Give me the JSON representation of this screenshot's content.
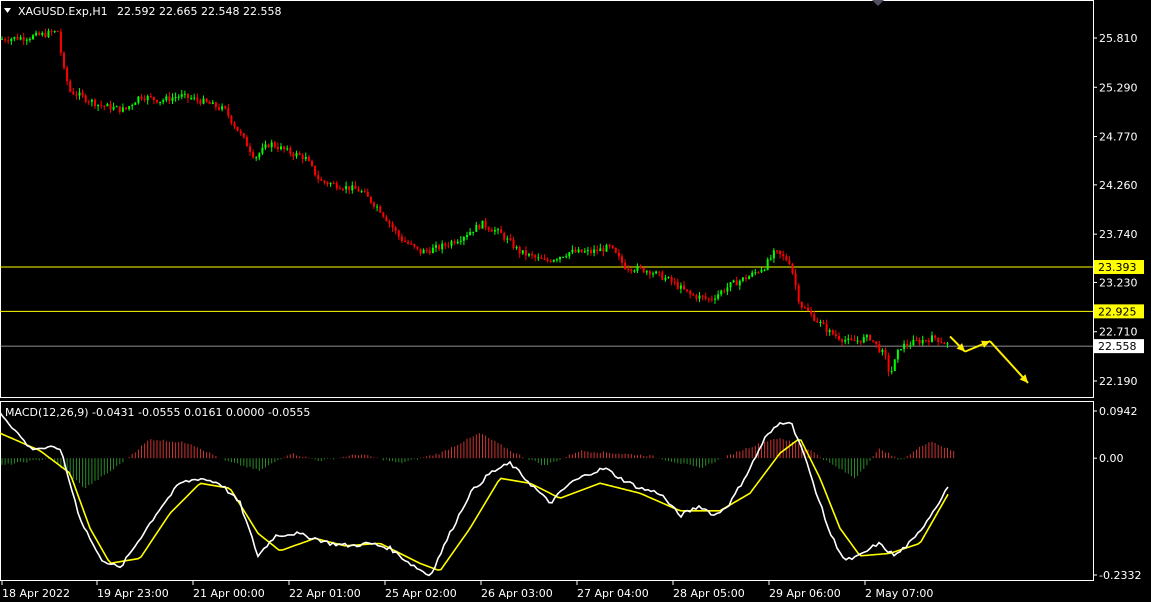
{
  "header": {
    "symbol": "XAGUSD.Exp,H1",
    "ohlc": "22.592 22.665 22.548 22.558",
    "macd_label": "MACD(12,26,9) -0.0431 -0.0555 0.0161 0.0000 -0.0555"
  },
  "colors": {
    "background": "#000000",
    "bull_candle": "#00ff00",
    "bear_candle": "#ff0000",
    "level_line": "#ffff00",
    "bid_line": "#c0c0c0",
    "macd_main": "#ffffff",
    "macd_signal": "#ffff00",
    "hist_pos": "#cc3333",
    "hist_neg": "#2a8a2a",
    "forecast_arrow": "#ffee00"
  },
  "chart_data": [
    {
      "type": "candlestick",
      "symbol": "XAGUSD",
      "timeframe": "H1",
      "ylim": [
        21.98,
        26.03
      ],
      "y_ticks": [
        "25.810",
        "25.290",
        "24.770",
        "24.260",
        "23.740",
        "23.230",
        "22.710",
        "22.190"
      ],
      "x_ticks": [
        "18 Apr 2022",
        "19 Apr 23:00",
        "21 Apr 00:00",
        "22 Apr 01:00",
        "25 Apr 02:00",
        "26 Apr 03:00",
        "27 Apr 04:00",
        "28 Apr 05:00",
        "29 Apr 06:00",
        "2 May 07:00"
      ],
      "close_path": [
        [
          0,
          25.8
        ],
        [
          30,
          25.82
        ],
        [
          45,
          25.85
        ],
        [
          58,
          25.88
        ],
        [
          63,
          25.5
        ],
        [
          70,
          25.25
        ],
        [
          100,
          25.1
        ],
        [
          125,
          25.05
        ],
        [
          140,
          25.2
        ],
        [
          160,
          25.15
        ],
        [
          180,
          25.2
        ],
        [
          200,
          25.15
        ],
        [
          225,
          25.05
        ],
        [
          240,
          24.8
        ],
        [
          255,
          24.55
        ],
        [
          270,
          24.7
        ],
        [
          290,
          24.6
        ],
        [
          305,
          24.55
        ],
        [
          320,
          24.3
        ],
        [
          340,
          24.25
        ],
        [
          360,
          24.2
        ],
        [
          380,
          24.0
        ],
        [
          400,
          23.7
        ],
        [
          420,
          23.55
        ],
        [
          440,
          23.6
        ],
        [
          460,
          23.7
        ],
        [
          482,
          23.85
        ],
        [
          500,
          23.75
        ],
        [
          520,
          23.55
        ],
        [
          545,
          23.45
        ],
        [
          570,
          23.55
        ],
        [
          590,
          23.55
        ],
        [
          610,
          23.6
        ],
        [
          625,
          23.4
        ],
        [
          650,
          23.35
        ],
        [
          670,
          23.25
        ],
        [
          690,
          23.1
        ],
        [
          710,
          23.05
        ],
        [
          730,
          23.2
        ],
        [
          750,
          23.3
        ],
        [
          765,
          23.4
        ],
        [
          775,
          23.55
        ],
        [
          790,
          23.45
        ],
        [
          800,
          23.0
        ],
        [
          815,
          22.85
        ],
        [
          830,
          22.7
        ],
        [
          850,
          22.6
        ],
        [
          870,
          22.65
        ],
        [
          885,
          22.45
        ],
        [
          890,
          22.25
        ],
        [
          900,
          22.55
        ],
        [
          915,
          22.6
        ],
        [
          935,
          22.65
        ],
        [
          950,
          22.56
        ]
      ],
      "levels": [
        {
          "label": "23.393",
          "value": 23.393
        },
        {
          "label": "22.925",
          "value": 22.925
        }
      ],
      "current_bid": {
        "label": "22.558",
        "value": 22.558
      },
      "forecast_path": [
        [
          950,
          22.66
        ],
        [
          965,
          22.5
        ],
        [
          990,
          22.61
        ],
        [
          1028,
          22.17
        ]
      ]
    },
    {
      "type": "macd",
      "params": "12,26,9",
      "ylim": [
        -0.2332,
        0.0942
      ],
      "y_ticks": [
        "0.0942",
        "0.00",
        "-0.2332"
      ],
      "main_path": [
        [
          0,
          0.092
        ],
        [
          30,
          0.02
        ],
        [
          60,
          0.02
        ],
        [
          80,
          -0.12
        ],
        [
          100,
          -0.2
        ],
        [
          120,
          -0.22
        ],
        [
          140,
          -0.16
        ],
        [
          160,
          -0.1
        ],
        [
          180,
          -0.05
        ],
        [
          200,
          -0.04
        ],
        [
          220,
          -0.05
        ],
        [
          240,
          -0.09
        ],
        [
          258,
          -0.195
        ],
        [
          275,
          -0.155
        ],
        [
          295,
          -0.15
        ],
        [
          315,
          -0.16
        ],
        [
          330,
          -0.17
        ],
        [
          350,
          -0.175
        ],
        [
          370,
          -0.17
        ],
        [
          390,
          -0.18
        ],
        [
          410,
          -0.21
        ],
        [
          430,
          -0.235
        ],
        [
          450,
          -0.15
        ],
        [
          470,
          -0.07
        ],
        [
          490,
          -0.03
        ],
        [
          510,
          -0.01
        ],
        [
          530,
          -0.05
        ],
        [
          550,
          -0.09
        ],
        [
          570,
          -0.05
        ],
        [
          590,
          -0.03
        ],
        [
          605,
          -0.02
        ],
        [
          620,
          -0.04
        ],
        [
          640,
          -0.06
        ],
        [
          660,
          -0.07
        ],
        [
          680,
          -0.115
        ],
        [
          700,
          -0.095
        ],
        [
          715,
          -0.115
        ],
        [
          730,
          -0.09
        ],
        [
          750,
          -0.02
        ],
        [
          765,
          0.04
        ],
        [
          780,
          0.07
        ],
        [
          790,
          0.075
        ],
        [
          800,
          0.03
        ],
        [
          815,
          -0.06
        ],
        [
          830,
          -0.15
        ],
        [
          845,
          -0.205
        ],
        [
          860,
          -0.195
        ],
        [
          878,
          -0.17
        ],
        [
          895,
          -0.195
        ],
        [
          915,
          -0.16
        ],
        [
          935,
          -0.1
        ],
        [
          950,
          -0.05
        ]
      ],
      "signal_path": [
        [
          0,
          0.05
        ],
        [
          40,
          0.015
        ],
        [
          70,
          -0.03
        ],
        [
          90,
          -0.14
        ],
        [
          110,
          -0.21
        ],
        [
          140,
          -0.2
        ],
        [
          170,
          -0.11
        ],
        [
          200,
          -0.05
        ],
        [
          230,
          -0.06
        ],
        [
          258,
          -0.15
        ],
        [
          280,
          -0.185
        ],
        [
          315,
          -0.16
        ],
        [
          345,
          -0.175
        ],
        [
          380,
          -0.17
        ],
        [
          420,
          -0.21
        ],
        [
          440,
          -0.225
        ],
        [
          470,
          -0.14
        ],
        [
          500,
          -0.04
        ],
        [
          530,
          -0.05
        ],
        [
          560,
          -0.08
        ],
        [
          600,
          -0.05
        ],
        [
          640,
          -0.07
        ],
        [
          680,
          -0.105
        ],
        [
          720,
          -0.105
        ],
        [
          750,
          -0.07
        ],
        [
          780,
          0.01
        ],
        [
          800,
          0.04
        ],
        [
          820,
          -0.04
        ],
        [
          840,
          -0.14
        ],
        [
          860,
          -0.195
        ],
        [
          890,
          -0.19
        ],
        [
          920,
          -0.17
        ],
        [
          950,
          -0.065
        ]
      ],
      "histogram": [
        [
          0,
          -0.015
        ],
        [
          50,
          0.0
        ],
        [
          85,
          -0.06
        ],
        [
          115,
          -0.02
        ],
        [
          150,
          0.038
        ],
        [
          190,
          0.03
        ],
        [
          225,
          -0.005
        ],
        [
          260,
          -0.025
        ],
        [
          290,
          0.01
        ],
        [
          320,
          -0.005
        ],
        [
          360,
          0.008
        ],
        [
          400,
          -0.01
        ],
        [
          440,
          0.01
        ],
        [
          480,
          0.05
        ],
        [
          515,
          0.01
        ],
        [
          545,
          -0.015
        ],
        [
          580,
          0.015
        ],
        [
          615,
          0.01
        ],
        [
          650,
          0.005
        ],
        [
          700,
          -0.02
        ],
        [
          740,
          0.015
        ],
        [
          775,
          0.04
        ],
        [
          800,
          0.03
        ],
        [
          830,
          -0.01
        ],
        [
          855,
          -0.04
        ],
        [
          870,
          -0.005
        ],
        [
          880,
          0.02
        ],
        [
          900,
          -0.005
        ],
        [
          930,
          0.035
        ],
        [
          955,
          0.012
        ]
      ]
    }
  ]
}
